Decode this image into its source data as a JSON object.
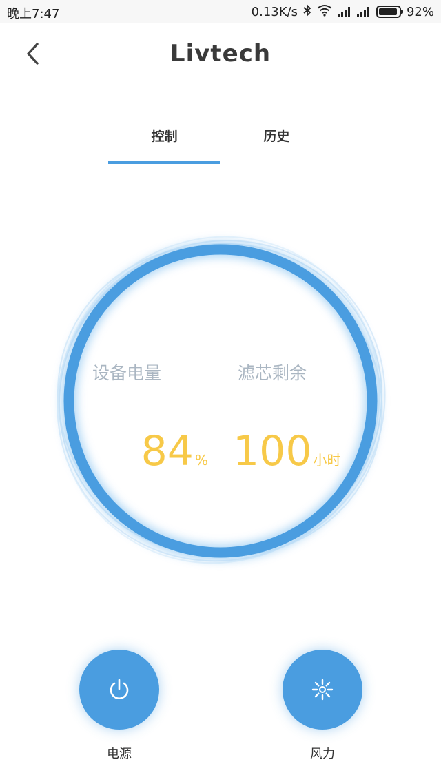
{
  "status_bar": {
    "time": "晚上7:47",
    "speed": "0.13K/s",
    "battery_percent": "92%",
    "battery_level": 0.92,
    "icons": [
      "bluetooth-icon",
      "wifi-icon",
      "signal-icon",
      "signal-icon",
      "battery-icon"
    ]
  },
  "header": {
    "logo": "Livtech",
    "back_icon": "chevron-left-icon"
  },
  "tabs": [
    {
      "label": "控制",
      "active": true
    },
    {
      "label": "历史",
      "active": false
    }
  ],
  "gauge": {
    "battery_label": "设备电量",
    "battery_value": "84",
    "battery_unit": "%",
    "filter_label": "滤芯剩余",
    "filter_value": "100",
    "filter_unit": "小时"
  },
  "buttons": {
    "power_label": "电源",
    "power_icon": "power-icon",
    "wind_label": "风力",
    "wind_icon": "fan-icon"
  },
  "colors": {
    "accent": "#4a9de0",
    "value": "#f7c948",
    "label": "#aab6c2"
  }
}
